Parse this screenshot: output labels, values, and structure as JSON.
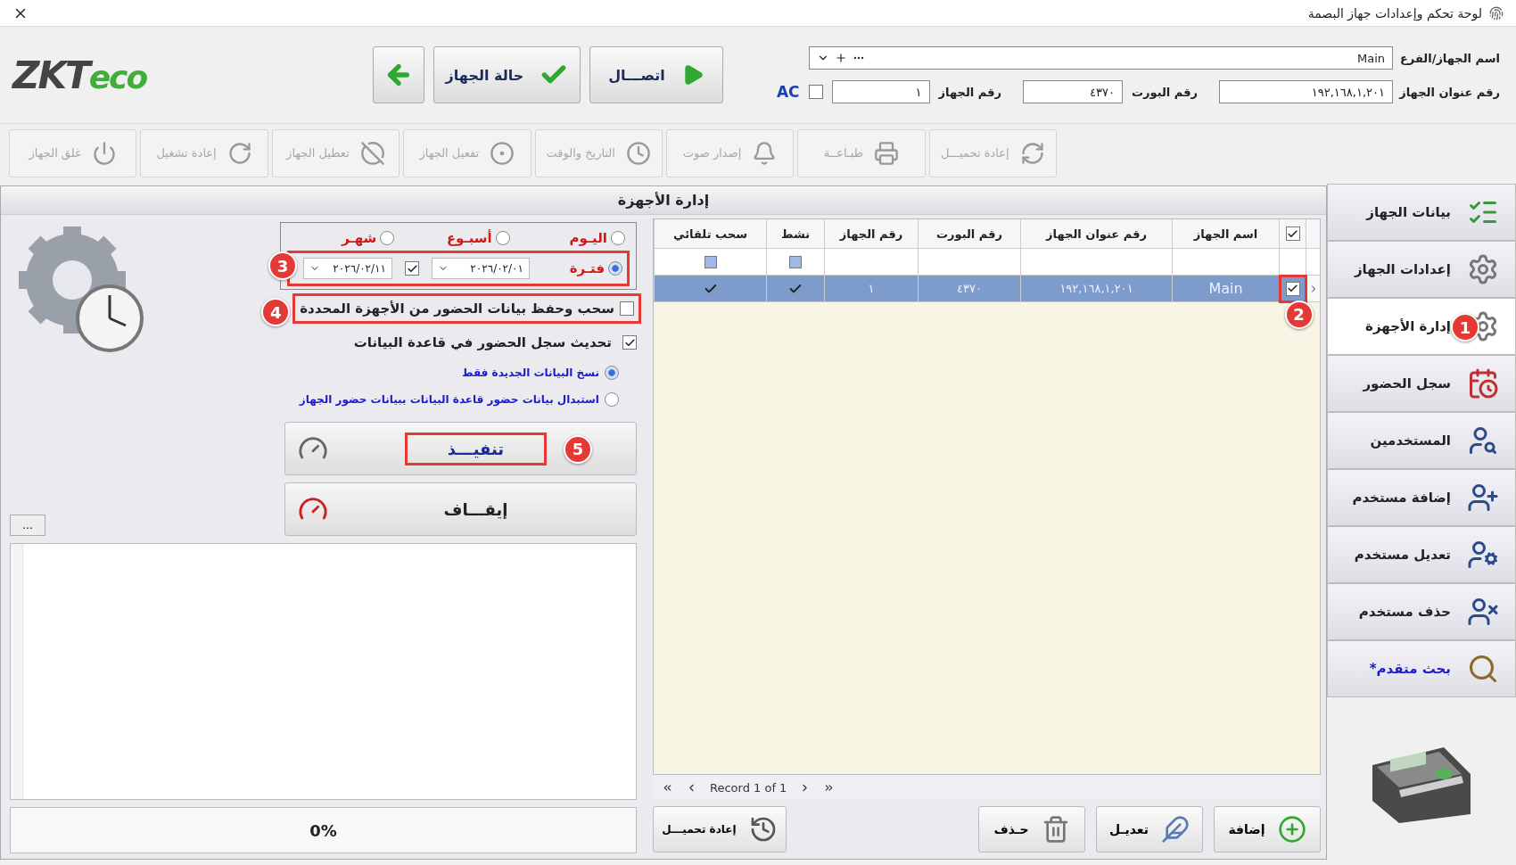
{
  "window": {
    "title": "لوحة تحكم وإعدادات جهاز البصمة"
  },
  "logo": {
    "main": "ZKT",
    "accent": "eco"
  },
  "connection": {
    "name_label": "اسم الجهاز/الفرع",
    "name_value": "Main",
    "ip_label": "رقم عنوان الجهاز",
    "ip_value": "١٩٢,١٦٨,١,٢٠١",
    "port_label": "رقم البورت",
    "port_value": "٤٣٧٠",
    "number_label": "رقم الجهاز",
    "number_value": "١",
    "ac": {
      "label": "AC",
      "checked": false
    }
  },
  "actions": [
    {
      "kind": "connect",
      "label": "اتصـــال"
    },
    {
      "kind": "status",
      "label": "حالة الجهاز"
    },
    {
      "kind": "back"
    }
  ],
  "toolbar": [
    {
      "kind": "reload",
      "label": "إعادة تحميـــل",
      "disabled": true
    },
    {
      "kind": "print",
      "label": "طبـاعــة",
      "disabled": true
    },
    {
      "kind": "sound",
      "label": "إصدار صوت",
      "disabled": true
    },
    {
      "kind": "clock",
      "label": "التاريخ والوقت",
      "disabled": true
    },
    {
      "kind": "enable",
      "label": "تفعيل الجهاز",
      "disabled": true
    },
    {
      "kind": "disable",
      "label": "تعطيل الجهاز",
      "disabled": true
    },
    {
      "kind": "restart",
      "label": "إعادة تشغيل",
      "disabled": true
    },
    {
      "kind": "power",
      "label": "غلق الجهاز",
      "disabled": true
    }
  ],
  "panel_title": "إدارة الأجهزة",
  "period": {
    "options": [
      {
        "label": "اليـوم",
        "selected": false
      },
      {
        "label": "أسبـوع",
        "selected": false
      },
      {
        "label": "شهـر",
        "selected": false
      },
      {
        "label": "فتـرة",
        "selected": true
      }
    ],
    "from": "٢٠٢٦/٠٢/٠١",
    "to_checked": true,
    "to": "٢٠٢٦/٠٢/١١",
    "annotation": {
      "number": "3",
      "boxed": true
    }
  },
  "options": [
    {
      "label": "سحب وحفظ بيانات الحضور من الأجهزة المحددة",
      "checked": false,
      "annotation": {
        "number": "4",
        "boxed": true
      }
    },
    {
      "label": "تحديث سجل الحضور في قاعدة البيانات",
      "checked": true
    }
  ],
  "mode": [
    {
      "label": "نسخ البيانات الجديدة فقط",
      "selected": true
    },
    {
      "label": "استبدال بيانات حضور قاعدة البيانات ببيانات حضور الجهاز",
      "selected": false
    }
  ],
  "execute": {
    "label": "تنفيـــذ",
    "annotation": {
      "number": "5",
      "boxed": true
    }
  },
  "stop": {
    "label": "إيقـــاف"
  },
  "more_button": "...",
  "progress": {
    "reading": "0%",
    "level": 0
  },
  "grid": {
    "header_checked": true,
    "filter_active_checked": false,
    "filter_auto_pull_checked": false,
    "columns": [
      "اسم الجهاز",
      "رقم عنوان الجهاز",
      "رقم البورت",
      "رقم الجهاز",
      "نشط",
      "سحب تلقائي"
    ],
    "rows": [
      {
        "selected": true,
        "checked": true,
        "cells": [
          "Main",
          "١٩٢,١٦٨,١,٢٠١",
          "٤٣٧٠",
          "١"
        ],
        "active": true,
        "auto_pull": true,
        "annotation": {
          "number": "2",
          "boxed": true
        }
      }
    ],
    "navigator": "Record 1 of 1"
  },
  "grid_buttons": [
    {
      "kind": "add",
      "label": "إضافة"
    },
    {
      "kind": "edit",
      "label": "تعديـل"
    },
    {
      "kind": "delete",
      "label": "حـذف"
    },
    {
      "kind": "reload",
      "label": "إعادة تحميـــل"
    }
  ],
  "sidebar": [
    {
      "kind": "list",
      "label": "بيانات الجهاز",
      "selected": false,
      "link": false
    },
    {
      "kind": "gears",
      "label": "إعدادات الجهاز",
      "selected": false,
      "link": false
    },
    {
      "kind": "gear-clock",
      "label": "إدارة الأجهزة",
      "selected": true,
      "link": false,
      "annotation": {
        "number": "1",
        "boxed": false
      }
    },
    {
      "kind": "calendar",
      "label": "سجل الحضور",
      "selected": false,
      "link": false
    },
    {
      "kind": "user-search",
      "label": "المستخدمين",
      "selected": false,
      "link": false
    },
    {
      "kind": "user-add",
      "label": "إضافة مستخدم",
      "selected": false,
      "link": false
    },
    {
      "kind": "user-edit",
      "label": "تعديل مستخدم",
      "selected": false,
      "link": false
    },
    {
      "kind": "user-remove",
      "label": "حذف مستخدم",
      "selected": false,
      "link": false
    },
    {
      "kind": "search",
      "label": "بحث متقدم*",
      "selected": false,
      "link": true
    }
  ]
}
